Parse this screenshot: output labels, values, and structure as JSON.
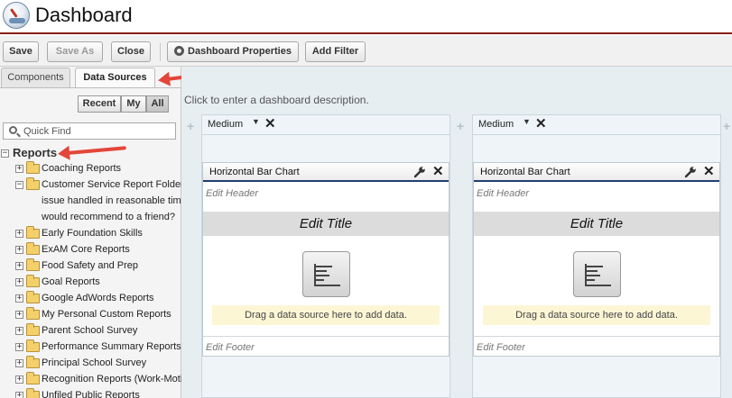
{
  "header": {
    "title": "Dashboard"
  },
  "toolbar": {
    "save": "Save",
    "save_as": "Save As",
    "close": "Close",
    "properties": "Dashboard Properties",
    "add_filter": "Add Filter"
  },
  "left_panel": {
    "tabs": [
      "Components",
      "Data Sources"
    ],
    "filters": [
      "Recent",
      "My",
      "All"
    ],
    "search_placeholder": "Quick Find",
    "root_label": "Reports",
    "items": [
      "Coaching Reports",
      "Customer Service Report Folder",
      "issue handled in reasonable time?",
      "would recommend to a friend?",
      "Early Foundation Skills",
      "ExAM Core Reports",
      "Food Safety and Prep",
      "Goal Reports",
      "Google AdWords Reports",
      "My Personal Custom Reports",
      "Parent School Survey",
      "Performance Summary Reports",
      "Principal School Survey",
      "Recognition Reports (Work-Motivation)",
      "Unfiled Public Reports"
    ]
  },
  "main": {
    "description": "Click to enter a dashboard description.",
    "columns": [
      {
        "size": "Medium",
        "widget": {
          "type": "Horizontal Bar Chart",
          "header": "Edit Header",
          "title": "Edit Title",
          "drop_hint": "Drag a data source here to add data.",
          "footer": "Edit Footer"
        }
      },
      {
        "size": "Medium",
        "widget": {
          "type": "Horizontal Bar Chart",
          "header": "Edit Header",
          "title": "Edit Title",
          "drop_hint": "Drag a data source here to add data.",
          "footer": "Edit Footer"
        }
      }
    ]
  },
  "colors": {
    "accent": "#8c1d14",
    "arrow": "#e4453a",
    "widget_rule": "#1f3f73",
    "drop_bg": "#fcf6d5"
  }
}
